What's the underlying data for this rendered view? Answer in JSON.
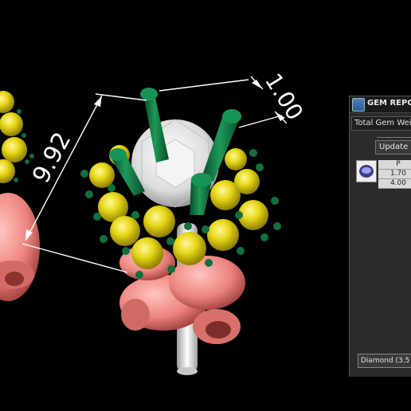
{
  "dimensions": {
    "height_label": "9.92",
    "prong_label": "1.00"
  },
  "panel": {
    "title": "GEM REPO",
    "total_label": "Total Gem Wei",
    "update_label": "Update",
    "gem_header": "P",
    "gem_values": [
      "1.70",
      "4.00"
    ],
    "footer_label": "Diamond  (3.5"
  },
  "colors": {
    "prong": "#0e6b3c",
    "yellow_gem": "#e8d81a",
    "center_gem": "#e4e4e4",
    "gallery": "#f08a86",
    "post": "#e6e6e6"
  }
}
